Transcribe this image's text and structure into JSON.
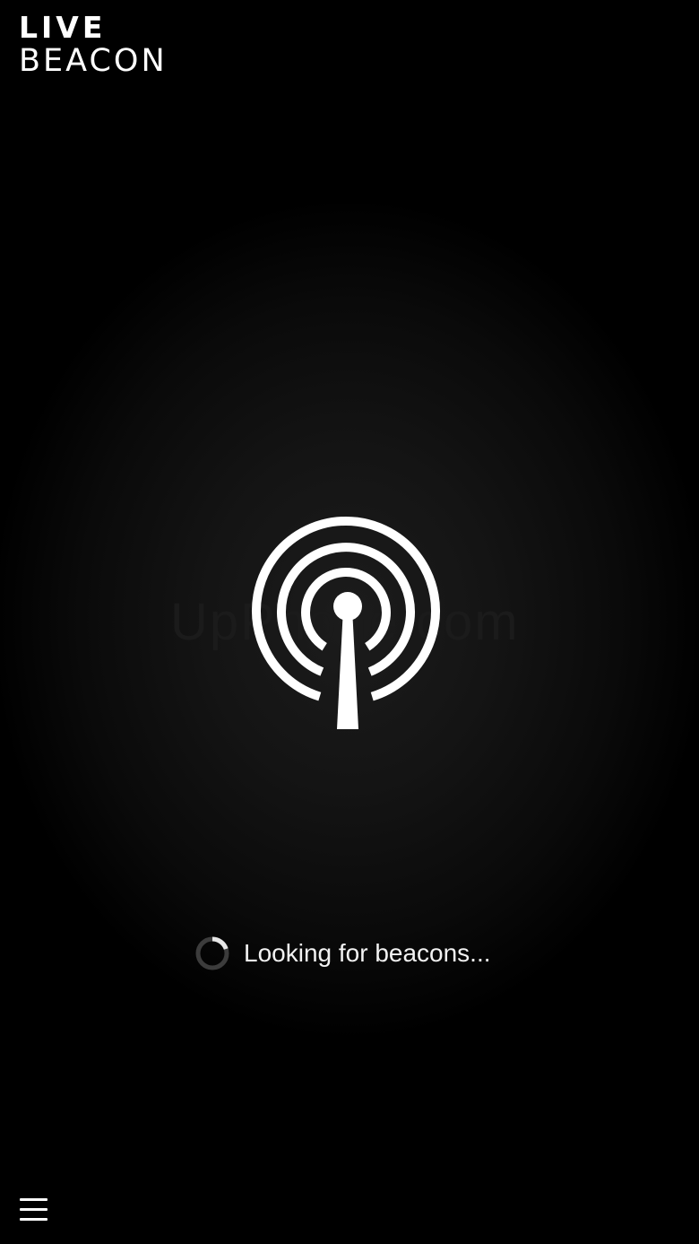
{
  "app": {
    "logo_line1": "LIVE",
    "logo_line2": "BEACON"
  },
  "main": {
    "icon": "beacon-broadcast-icon",
    "watermark": "UpPhone.com",
    "status_text": "Looking for beacons...",
    "status_icon": "loading-spinner-icon"
  },
  "footer": {
    "menu_icon": "hamburger-menu-icon"
  },
  "colors": {
    "background": "#000000",
    "foreground": "#ffffff"
  }
}
